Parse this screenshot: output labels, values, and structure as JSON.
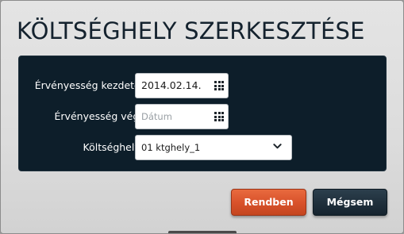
{
  "dialog": {
    "title": "KÖLTSÉGHELY SZERKESZTÉSE"
  },
  "form": {
    "fields": [
      {
        "label": "Érvényesség kezdete*",
        "value": "2014.02.14.",
        "placeholder": "",
        "icon": "calendar-grid-icon"
      },
      {
        "label": "Érvényesség vége",
        "value": "",
        "placeholder": "Dátum",
        "icon": "calendar-grid-icon"
      },
      {
        "label": "Költséghely*",
        "value": "01 ktghely_1",
        "placeholder": "",
        "icon": "chevron-down-icon"
      }
    ]
  },
  "buttons": {
    "ok_label": "Rendben",
    "cancel_label": "Mégsem"
  },
  "colors": {
    "panel_bg": "#0d1e2a",
    "title_text": "#14222e",
    "ok_button": "#d8512a",
    "cancel_button": "#1f2f3b"
  }
}
